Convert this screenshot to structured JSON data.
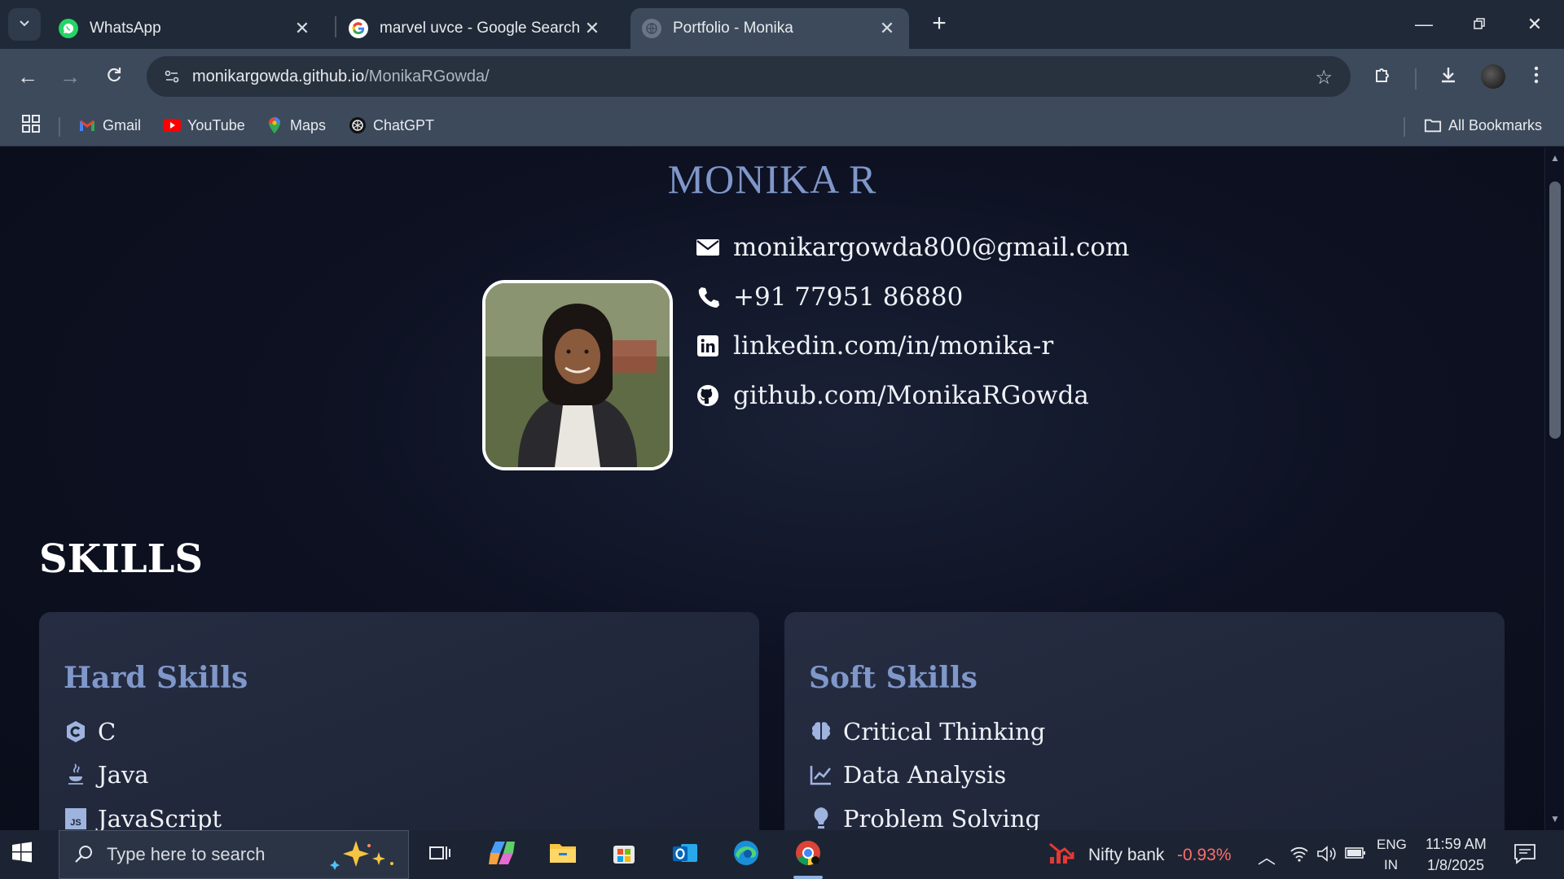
{
  "browser": {
    "tabs": [
      {
        "title": "WhatsApp",
        "icon": "whatsapp-icon"
      },
      {
        "title": "marvel uvce - Google Search",
        "icon": "google-icon"
      },
      {
        "title": "Portfolio - Monika",
        "icon": "globe-icon",
        "active": true
      }
    ],
    "url_host": "monikargowda.github.io",
    "url_path": "/MonikaRGowda/",
    "bookmarks": [
      "Gmail",
      "YouTube",
      "Maps",
      "ChatGPT"
    ],
    "all_bookmarks": "All Bookmarks"
  },
  "page": {
    "name": "MONIKA R",
    "contacts": {
      "email": "monikargowda800@gmail.com",
      "phone": "+91 77951 86880",
      "linkedin": "linkedin.com/in/monika-r",
      "github": "github.com/MonikaRGowda"
    },
    "skills_heading": "SKILLS",
    "hard_skills": {
      "title": "Hard Skills",
      "items": [
        "C",
        "Java",
        "JavaScript"
      ]
    },
    "soft_skills": {
      "title": "Soft Skills",
      "items": [
        "Critical Thinking",
        "Data Analysis",
        "Problem Solving"
      ]
    }
  },
  "taskbar": {
    "search_placeholder": "Type here to search",
    "stock_name": "Nifty bank",
    "stock_change": "-0.93%",
    "lang_top": "ENG",
    "lang_bottom": "IN",
    "time": "11:59 AM",
    "date": "1/8/2025"
  },
  "colors": {
    "accent": "#7f97c9",
    "stock_negative": "#ff6b6b"
  }
}
